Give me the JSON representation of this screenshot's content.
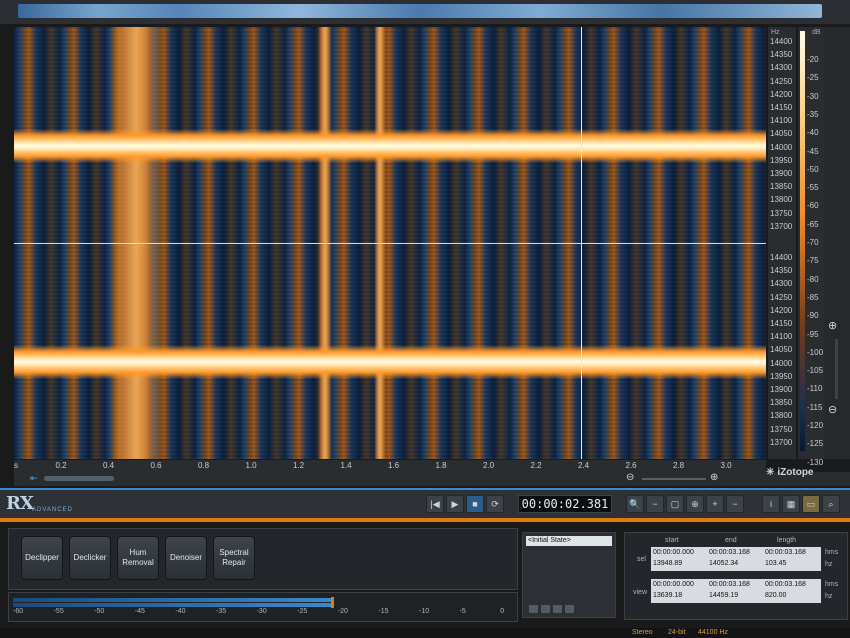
{
  "spectrogram": {
    "freq_ticks": [
      "14400",
      "14350",
      "14300",
      "14250",
      "14200",
      "14150",
      "14100",
      "14050",
      "14000",
      "13950",
      "13900",
      "13850",
      "13800",
      "13750",
      "13700"
    ],
    "freq_unit": "Hz",
    "db_unit": "dB",
    "db_ticks": [
      "-20",
      "-25",
      "-30",
      "-35",
      "-40",
      "-45",
      "-50",
      "-55",
      "-60",
      "-65",
      "-70",
      "-75",
      "-80",
      "-85",
      "-90",
      "-95",
      "-100",
      "-105",
      "-110",
      "-115",
      "-120",
      "-125",
      "-130"
    ],
    "time_ticks": [
      "s",
      "0.2",
      "0.4",
      "0.6",
      "0.8",
      "1.0",
      "1.2",
      "1.4",
      "1.6",
      "1.8",
      "2.0",
      "2.2",
      "2.4",
      "2.6",
      "2.8",
      "3.0"
    ],
    "brand": "iZotope"
  },
  "app": {
    "logo": "RX",
    "edition": "ADVANCED",
    "timecode": "00:00:02.381"
  },
  "transport": [
    "|◀",
    "▶",
    "■",
    "⟳"
  ],
  "tools": [
    {
      "label": "Declipper"
    },
    {
      "label": "Declicker"
    },
    {
      "label": "Hum Removal"
    },
    {
      "label": "Denoiser"
    },
    {
      "label": "Spectral Repair"
    }
  ],
  "meter": {
    "ticks": [
      "-60",
      "-55",
      "-50",
      "-45",
      "-40",
      "-35",
      "-30",
      "-25",
      "-20",
      "-15",
      "-10",
      "-5",
      "0"
    ],
    "level_db": -24
  },
  "history": {
    "items": [
      "<Initial State>"
    ]
  },
  "selection": {
    "headers": [
      "start",
      "end",
      "length"
    ],
    "sel_label": "sel",
    "view_label": "view",
    "sel_hms": [
      "00:00:00.000",
      "00:00:03.168",
      "00:00:03.168"
    ],
    "sel_hz": [
      "13948.89",
      "14052.34",
      "103.45"
    ],
    "view_hms": [
      "00:00:00.000",
      "00:00:03.168",
      "00:00:03.168"
    ],
    "view_hz": [
      "13639.18",
      "14459.19",
      "820.00"
    ],
    "unit_hms": "hms",
    "unit_hz": "hz"
  },
  "status": {
    "channels": "Stereo",
    "bitdepth": "24-bit",
    "samplerate": "44100 Hz"
  },
  "colors": {
    "accent_orange": "#e07a10",
    "accent_blue": "#3a8ad0"
  }
}
